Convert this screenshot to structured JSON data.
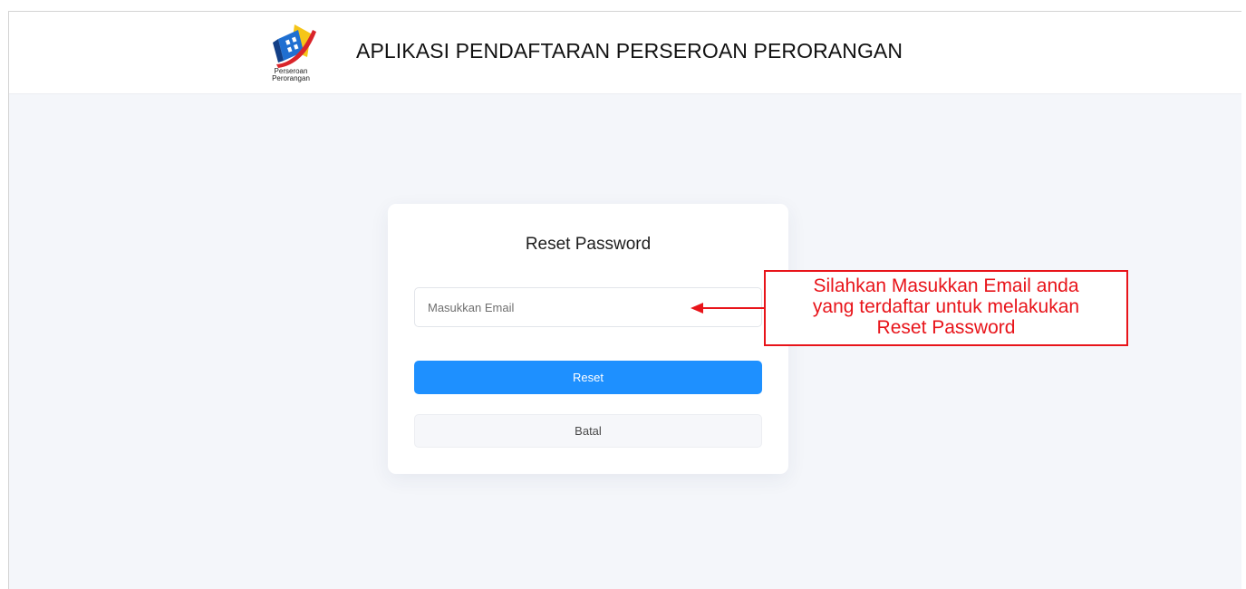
{
  "header": {
    "logo_caption_line1": "Perseroan",
    "logo_caption_line2": "Perorangan",
    "logo_icon": "perseroan-perorangan-logo",
    "title": "APLIKASI PENDAFTARAN PERSEROAN PERORANGAN"
  },
  "reset_form": {
    "title": "Reset Password",
    "email_placeholder": "Masukkan Email",
    "email_value": "",
    "reset_label": "Reset",
    "cancel_label": "Batal"
  },
  "annotation": {
    "line1": "Silahkan Masukkan Email anda",
    "line2": "yang terdaftar untuk melakukan",
    "line3": "Reset Password",
    "color": "#e8141a"
  },
  "colors": {
    "primary": "#1e90ff",
    "page_background": "#f4f6fa",
    "card_background": "#ffffff"
  }
}
